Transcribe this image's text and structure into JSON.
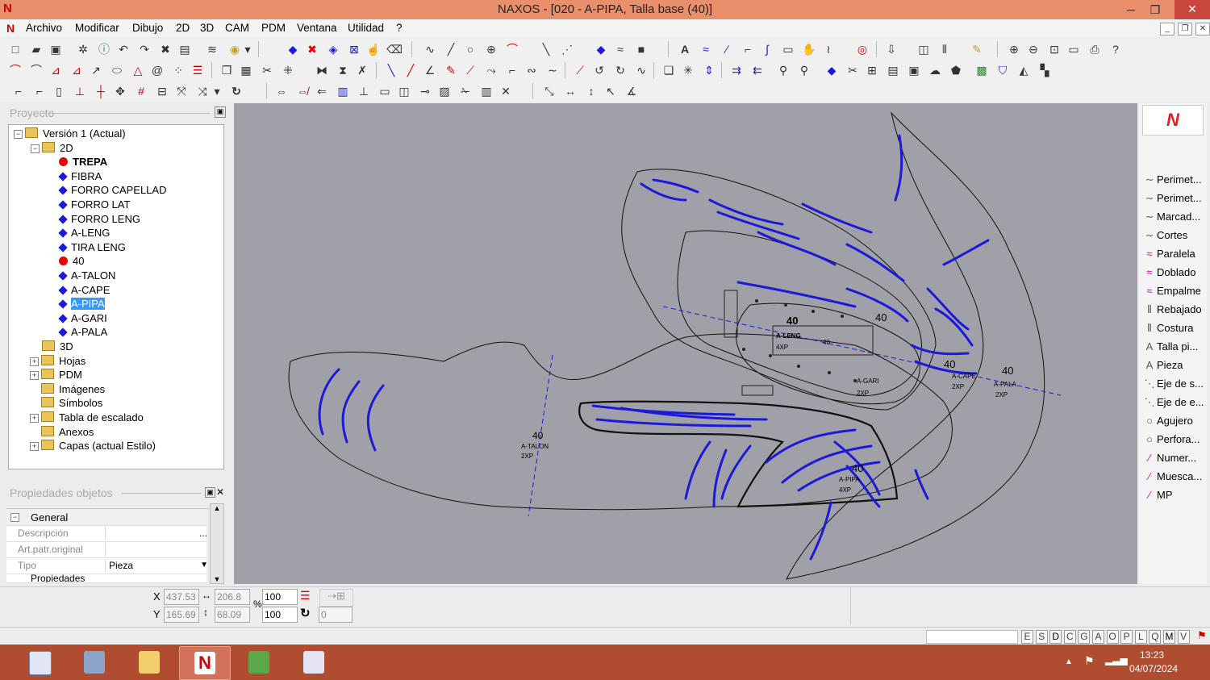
{
  "window": {
    "title": "NAXOS - [020 - A-PIPA, Talla base (40)]",
    "logo": "N",
    "minimize": "─",
    "maximize": "❐",
    "close": "✕"
  },
  "menu": [
    "Archivo",
    "Modificar",
    "Dibujo",
    "2D",
    "3D",
    "CAM",
    "PDM",
    "Ventana",
    "Utilidad",
    "?"
  ],
  "mdi_controls": [
    "_",
    "❐",
    "✕"
  ],
  "project": {
    "header": "Proyecto",
    "tree": [
      {
        "label": "Versión 1 (Actual)",
        "icon": "version-icon"
      },
      {
        "label": "2D",
        "icon": "2d-icon"
      },
      {
        "label": "TREPA",
        "icon": "red-dot",
        "bold": true
      },
      {
        "label": "FIBRA",
        "icon": "blue-diamond"
      },
      {
        "label": "FORRO CAPELLAD",
        "icon": "blue-diamond"
      },
      {
        "label": "FORRO LAT",
        "icon": "blue-diamond"
      },
      {
        "label": "FORRO LENG",
        "icon": "blue-diamond"
      },
      {
        "label": "A-LENG",
        "icon": "blue-diamond"
      },
      {
        "label": "TIRA LENG",
        "icon": "blue-diamond"
      },
      {
        "label": "40",
        "icon": "red-dot"
      },
      {
        "label": "A-TALON",
        "icon": "blue-diamond"
      },
      {
        "label": "A-CAPE",
        "icon": "blue-diamond"
      },
      {
        "label": "A-PIPA",
        "icon": "blue-diamond",
        "selected": true
      },
      {
        "label": "A-GARI",
        "icon": "blue-diamond"
      },
      {
        "label": "A-PALA",
        "icon": "blue-diamond"
      },
      {
        "label": "3D",
        "icon": "3d-icon"
      },
      {
        "label": "Hojas",
        "icon": "folder"
      },
      {
        "label": "PDM",
        "icon": "folder"
      },
      {
        "label": "Imágenes",
        "icon": "image-icon"
      },
      {
        "label": "Símbolos",
        "icon": "symbol-icon"
      },
      {
        "label": "Tabla de escalado",
        "icon": "table-icon"
      },
      {
        "label": "Anexos",
        "icon": "clip-icon"
      },
      {
        "label": "Capas (actual Estilo)",
        "icon": "layers-icon"
      }
    ]
  },
  "properties": {
    "header": "Propiedades objetos",
    "section": "General",
    "rows": [
      {
        "label": "Descripción",
        "value": "...",
        "muted": true
      },
      {
        "label": "Art.patr.original",
        "value": ""
      },
      {
        "label": "Tipo",
        "value": "Pieza"
      }
    ],
    "next_section": "Propiedades"
  },
  "canvas_labels": [
    {
      "text": "40"
    },
    {
      "text": "40"
    },
    {
      "text": "A-LENG"
    },
    {
      "text": "4XP"
    },
    {
      "text": "40"
    },
    {
      "text": "40"
    },
    {
      "text": "A-TALON"
    },
    {
      "text": "2XP"
    },
    {
      "text": "40"
    },
    {
      "text": "A-PIPA"
    },
    {
      "text": "4XP"
    },
    {
      "text": "A-GARI"
    },
    {
      "text": "2XP"
    },
    {
      "text": "40"
    },
    {
      "text": "A-CAPE"
    },
    {
      "text": "2XP"
    },
    {
      "text": "40"
    },
    {
      "text": "A-PALA"
    },
    {
      "text": "2XP"
    }
  ],
  "palette": [
    "Perimet...",
    "Perimet...",
    "Marcad...",
    "Cortes",
    "Paralela",
    "Doblado",
    "Empalme",
    "Rebajado",
    "Costura",
    "Talla pi...",
    "Pieza",
    "Eje de s...",
    "Eje de e...",
    "Agujero",
    "Perfora...",
    "Numer...",
    "Muesca...",
    "MP"
  ],
  "coords": {
    "x_label": "X",
    "y_label": "Y",
    "x": "437.53",
    "y": "165.69",
    "w": "206.8",
    "h": "68.09",
    "pct_label": "%",
    "sx": "100",
    "sy": "100",
    "angle": "0"
  },
  "status_cells": [
    "E",
    "S",
    "D",
    "C",
    "G",
    "A",
    "O",
    "P",
    "L",
    "Q",
    "M",
    "V"
  ],
  "taskbar": {
    "time": "13:23",
    "date": "04/07/2024"
  }
}
